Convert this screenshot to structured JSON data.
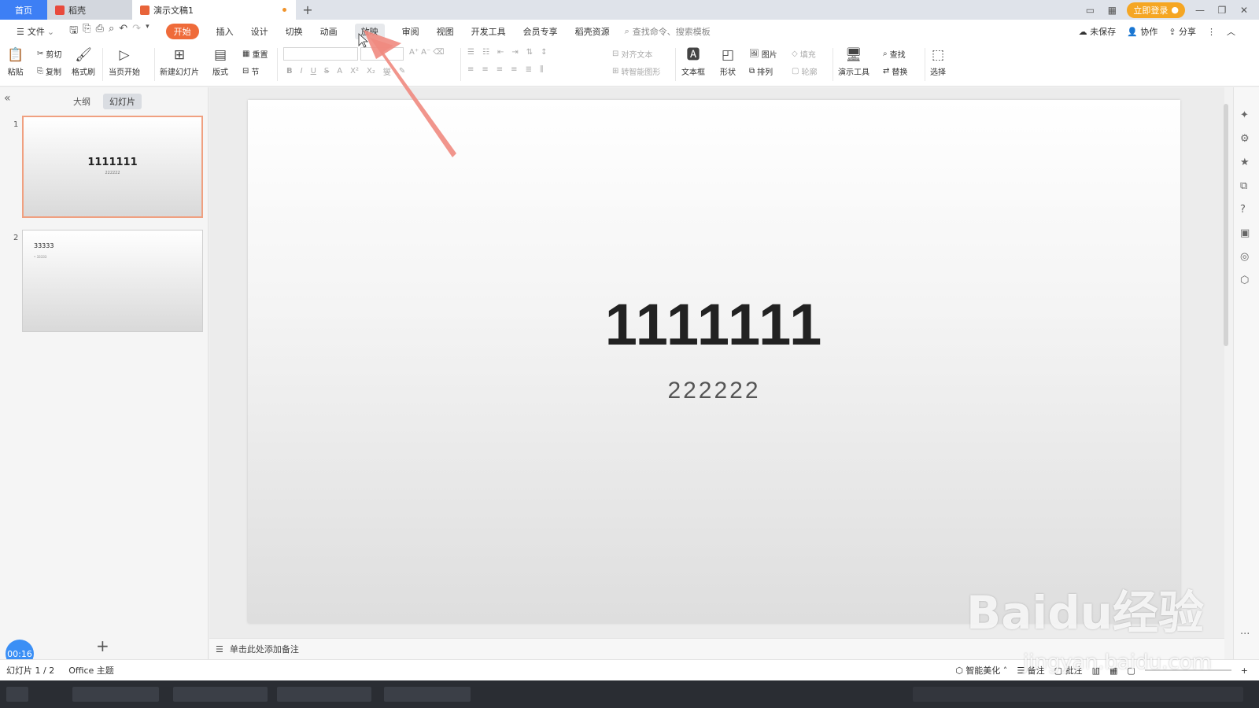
{
  "tabs": {
    "home": "首页",
    "doc1": "稻壳",
    "doc2": "演示文稿1",
    "new_tab": "+"
  },
  "title_right": {
    "login": "立即登录"
  },
  "menu": {
    "file": "文件",
    "items": [
      "开始",
      "插入",
      "设计",
      "切换",
      "动画",
      "放映",
      "审阅",
      "视图",
      "开发工具",
      "会员专享",
      "稻壳资源"
    ],
    "search": "查找命令、搜索模板",
    "unsaved": "未保存",
    "collab": "协作",
    "share": "分享"
  },
  "ribbon": {
    "paste": "粘贴",
    "cut": "剪切",
    "copy": "复制",
    "format_painter": "格式刷",
    "play_current": "当页开始",
    "new_slide": "新建幻灯片",
    "layout": "版式",
    "section": "节",
    "reset": "重置",
    "align_text": "对齐文本",
    "smart_art": "转智能图形",
    "textbox": "文本框",
    "shape": "形状",
    "picture": "图片",
    "arrange": "排列",
    "fill": "填充",
    "outline": "轮廓",
    "present_tools": "演示工具",
    "find": "查找",
    "replace": "替换",
    "select": "选择"
  },
  "left_panel": {
    "tab_outline": "大纲",
    "tab_slides": "幻灯片",
    "slide1_num": "1",
    "slide1_title": "1111111",
    "slide1_sub": "222222",
    "slide2_num": "2",
    "slide2_title": "33333",
    "slide2_bullet": "• 33333",
    "timer": "00:16"
  },
  "slide": {
    "title": "1111111",
    "subtitle": "222222"
  },
  "notes": {
    "placeholder": "单击此处添加备注"
  },
  "status": {
    "slide_count": "幻灯片 1 / 2",
    "theme": "Office 主题",
    "beautify": "智能美化",
    "notes": "备注",
    "comments": "批注"
  },
  "watermark": {
    "main": "Baidu经验",
    "sub": "jingyan.baidu.com"
  },
  "colors": {
    "accent": "#ef6b3a",
    "home_tab": "#3d7ff5",
    "arrow": "#f08a80"
  }
}
